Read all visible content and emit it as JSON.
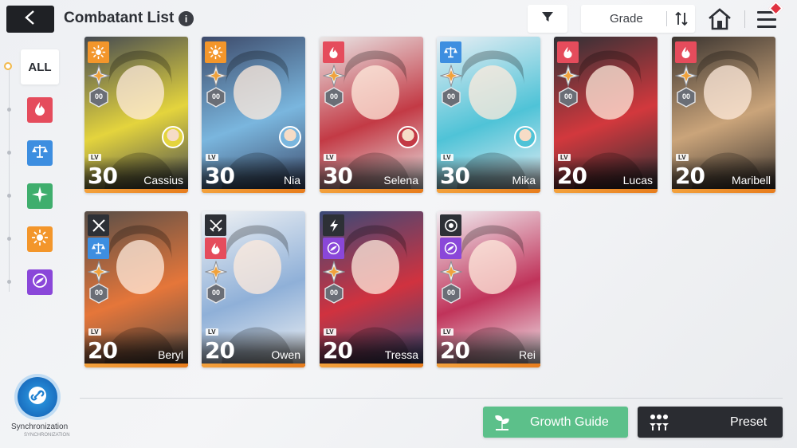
{
  "header": {
    "title": "Combatant List",
    "info_glyph": "i",
    "sort_label": "Grade"
  },
  "sidebar": {
    "all_label": "ALL",
    "filters": [
      {
        "name": "fire",
        "color": "#e54c5c"
      },
      {
        "name": "balance",
        "color": "#3d8ee0"
      },
      {
        "name": "wind",
        "color": "#3fae6d"
      },
      {
        "name": "light",
        "color": "#f3962b"
      },
      {
        "name": "void",
        "color": "#8a47d9"
      }
    ],
    "sync_label": "Synchronization",
    "sync_sub": "SYNCHRONIZATION"
  },
  "cards": [
    {
      "name": "Cassius",
      "level": "30",
      "rank": "00",
      "element": "light",
      "element_color": "#f3962b",
      "art_color": "#454a52",
      "art_accent": "#e4d43d",
      "has_partner": true,
      "class_icon": null
    },
    {
      "name": "Nia",
      "level": "30",
      "rank": "00",
      "element": "light",
      "element_color": "#f3962b",
      "art_color": "#3d4a6a",
      "art_accent": "#7ab6de",
      "has_partner": true,
      "class_icon": null
    },
    {
      "name": "Selena",
      "level": "30",
      "rank": "00",
      "element": "fire",
      "element_color": "#e54c5c",
      "art_color": "#e9e6e6",
      "art_accent": "#c33a45",
      "has_partner": true,
      "class_icon": null
    },
    {
      "name": "Mika",
      "level": "30",
      "rank": "00",
      "element": "balance",
      "element_color": "#3d8ee0",
      "art_color": "#e8eef4",
      "art_accent": "#4fc3d7",
      "has_partner": true,
      "class_icon": null
    },
    {
      "name": "Lucas",
      "level": "20",
      "rank": "00",
      "element": "fire",
      "element_color": "#e54c5c",
      "art_color": "#2f3136",
      "art_accent": "#d2383d",
      "has_partner": false,
      "class_icon": null
    },
    {
      "name": "Maribell",
      "level": "20",
      "rank": "00",
      "element": "fire",
      "element_color": "#e54c5c",
      "art_color": "#3a3430",
      "art_accent": "#caa47a",
      "has_partner": false,
      "class_icon": null
    },
    {
      "name": "Beryl",
      "level": "20",
      "rank": "00",
      "element": "balance",
      "element_color": "#3d8ee0",
      "art_color": "#574e48",
      "art_accent": "#e5763a",
      "has_partner": false,
      "class_icon": "crossed-swords"
    },
    {
      "name": "Owen",
      "level": "20",
      "rank": "00",
      "element": "fire",
      "element_color": "#e54c5c",
      "art_color": "#f0f2f4",
      "art_accent": "#8fb0d8",
      "has_partner": false,
      "class_icon": "crossed-blades"
    },
    {
      "name": "Tressa",
      "level": "20",
      "rank": "00",
      "element": "void",
      "element_color": "#8a47d9",
      "art_color": "#3a4a78",
      "art_accent": "#d0323f",
      "has_partner": false,
      "class_icon": "lightning"
    },
    {
      "name": "Rei",
      "level": "20",
      "rank": "00",
      "element": "void",
      "element_color": "#8a47d9",
      "art_color": "#f1eef2",
      "art_accent": "#c0335a",
      "has_partner": false,
      "class_icon": "target"
    }
  ],
  "card_labels": {
    "lv": "LV"
  },
  "footer": {
    "growth_label": "Growth Guide",
    "preset_label": "Preset"
  },
  "colors": {
    "growth": "#5cc08a",
    "preset": "#2a2c31",
    "level_bar": "#f3a13c"
  }
}
